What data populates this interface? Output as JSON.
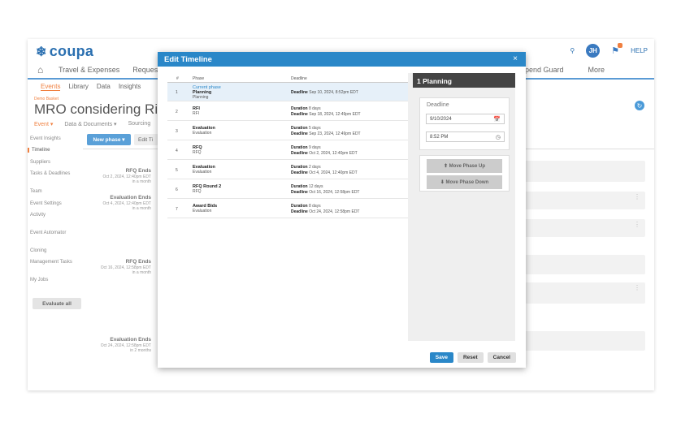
{
  "app": {
    "logo": "coupa",
    "help": "HELP",
    "avatar": "JH",
    "nav": [
      "Travel & Expenses",
      "Requests"
    ],
    "nav_right": [
      "pend Guard",
      "More"
    ],
    "subnav": [
      "Events",
      "Library",
      "Data",
      "Insights"
    ]
  },
  "event": {
    "demo": "Demo Basket",
    "title": "MRO considering Risk",
    "tabs": [
      "Event ▾",
      "Data & Documents ▾",
      "Sourcing"
    ]
  },
  "sidebar": {
    "items": [
      "Event Insights",
      "Timeline",
      "Suppliers",
      "Tasks & Deadlines",
      "Team",
      "Event Settings",
      "Activity",
      "Event Automator",
      "Cloning",
      "Management Tasks",
      "My Jobs"
    ],
    "evaluate_all": "Evaluate all"
  },
  "toolbar": {
    "new_phase": "New phase ▾",
    "edit_timeline": "Edit Ti"
  },
  "background_events": [
    {
      "title": "RFQ Ends",
      "date": "Oct 2, 2024, 12:40pm EDT",
      "rel": "in a month"
    },
    {
      "title": "Evaluation Ends",
      "date": "Oct 4, 2024, 12:40pm EDT",
      "rel": "in a month"
    },
    {
      "title": "RFQ Ends",
      "date": "Oct 16, 2024, 12:58pm EDT",
      "rel": "in a month"
    },
    {
      "title": "Evaluation Ends",
      "date": "Oct 24, 2024, 12:58pm EDT",
      "rel": "in 2 months"
    }
  ],
  "modal": {
    "title": "Edit Timeline",
    "close": "×",
    "columns": [
      "#",
      "Phase",
      "Deadline"
    ],
    "rows": [
      {
        "num": "1",
        "current": "Current phase",
        "name": "Planning",
        "sub": "Planning",
        "label": "Deadline",
        "value": "Sep 10, 2024, 8:52pm EDT",
        "label2": "",
        "value2": ""
      },
      {
        "num": "2",
        "current": "",
        "name": "RFI",
        "sub": "RFI",
        "label": "Duration",
        "value": "8 days",
        "label2": "Deadline",
        "value2": "Sep 18, 2024, 12:49pm EDT"
      },
      {
        "num": "3",
        "current": "",
        "name": "Evaluation",
        "sub": "Evaluation",
        "label": "Duration",
        "value": "5 days",
        "label2": "Deadline",
        "value2": "Sep 23, 2024, 12:49pm EDT"
      },
      {
        "num": "4",
        "current": "",
        "name": "RFQ",
        "sub": "RFQ",
        "label": "Duration",
        "value": "9 days",
        "label2": "Deadline",
        "value2": "Oct 2, 2024, 12:40pm EDT"
      },
      {
        "num": "5",
        "current": "",
        "name": "Evaluation",
        "sub": "Evaluation",
        "label": "Duration",
        "value": "2 days",
        "label2": "Deadline",
        "value2": "Oct 4, 2024, 12:40pm EDT"
      },
      {
        "num": "6",
        "current": "",
        "name": "RFQ Round 2",
        "sub": "RFQ",
        "label": "Duration",
        "value": "12 days",
        "label2": "Deadline",
        "value2": "Oct 16, 2024, 12:58pm EDT"
      },
      {
        "num": "7",
        "current": "",
        "name": "Award Bids",
        "sub": "Evaluation",
        "label": "Duration",
        "value": "8 days",
        "label2": "Deadline",
        "value2": "Oct 24, 2024, 12:58pm EDT"
      }
    ],
    "panel": {
      "header": "1 Planning",
      "deadline_label": "Deadline",
      "date_value": "9/10/2024",
      "time_value": "8:52 PM",
      "move_up": "⬆ Move Phase Up",
      "move_down": "⬇ Move Phase Down"
    },
    "buttons": {
      "save": "Save",
      "reset": "Reset",
      "cancel": "Cancel"
    }
  }
}
